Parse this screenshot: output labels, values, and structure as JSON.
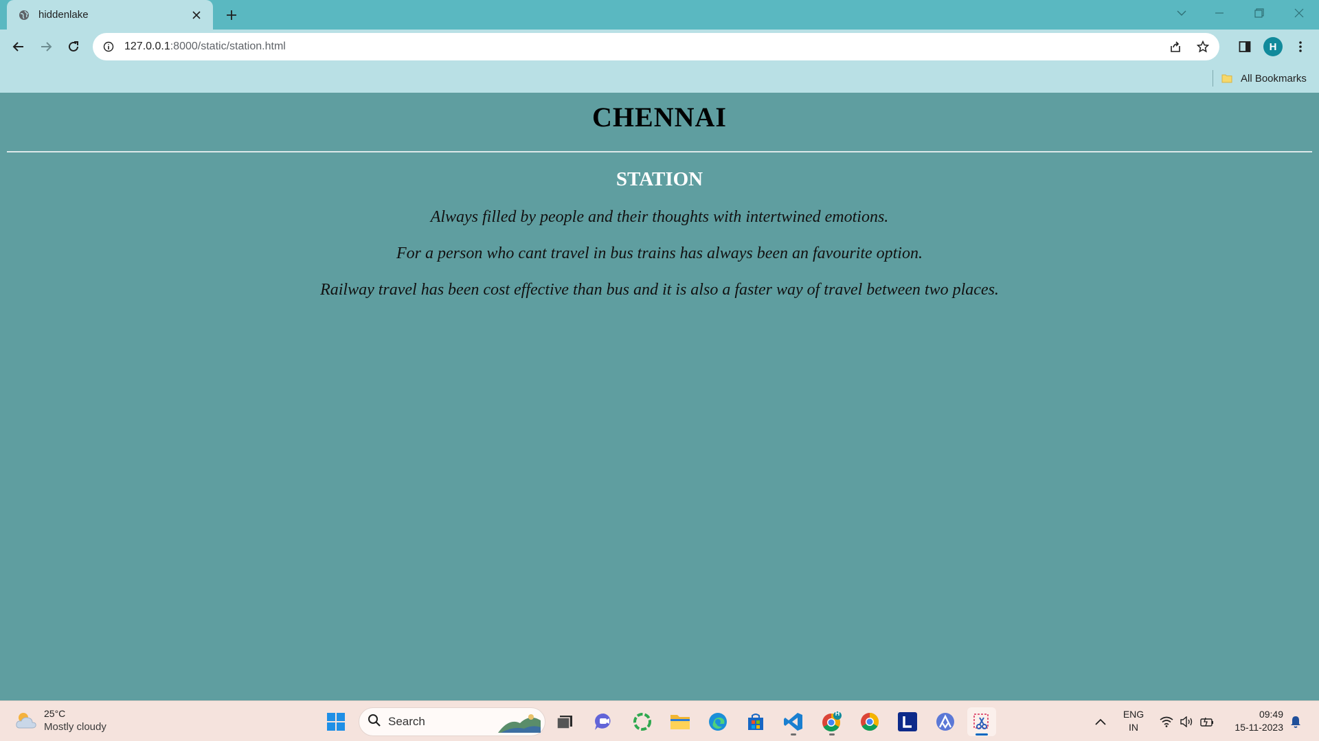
{
  "browser": {
    "tab_title": "hiddenlake",
    "url_host": "127.0.0.1",
    "url_path": ":8000/static/station.html",
    "profile_initial": "H",
    "bookmarks_label": "All Bookmarks"
  },
  "page": {
    "title": "CHENNAI",
    "section_title": "STATION",
    "paragraphs": [
      "Always filled by people and their thoughts with intertwined emotions.",
      "For a person who cant travel in bus trains has always been an favourite option.",
      "Railway travel has been cost effective than bus and it is also a faster way of travel between two places."
    ]
  },
  "taskbar": {
    "weather_temp": "25°C",
    "weather_desc": "Mostly cloudy",
    "search_placeholder": "Search",
    "chrome_badge": "H",
    "lang_line1": "ENG",
    "lang_line2": "IN",
    "time": "09:49",
    "date": "15-11-2023",
    "apps": [
      "start-icon",
      "task-view-icon",
      "teams-icon",
      "app-ring-icon",
      "file-explorer-icon",
      "edge-icon",
      "store-icon",
      "vscode-icon",
      "chrome-profile-icon",
      "chrome-icon",
      "l-app-icon",
      "arc-icon",
      "snipping-tool-icon"
    ]
  },
  "colors": {
    "page_background": "#5f9ea0",
    "browser_frame": "#5ab8c1",
    "toolbar": "#b9e0e5",
    "taskbar": "#f5e3dd"
  }
}
